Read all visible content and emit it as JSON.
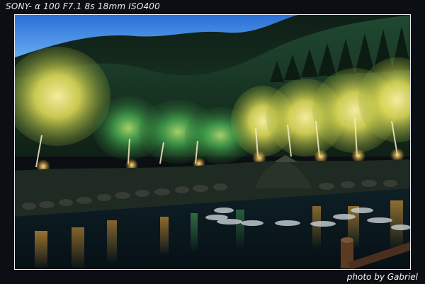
{
  "photo": {
    "exif_caption": "SONY- α 100 F7.1 8s 18mm ISO400",
    "credit": "photo by Gabriel"
  },
  "colors": {
    "frame_border": "#e9eef5",
    "sky_top": "#2a6fd6",
    "sky_mid": "#5ea6ef",
    "mountain_dark": "#12281c",
    "mountain_mid": "#1f4a2f",
    "foliage_yellow": "#e6e35a",
    "foliage_green": "#3fbf4a",
    "pond_dark": "#0b1a22",
    "pond_glow": "#f1b93a"
  }
}
